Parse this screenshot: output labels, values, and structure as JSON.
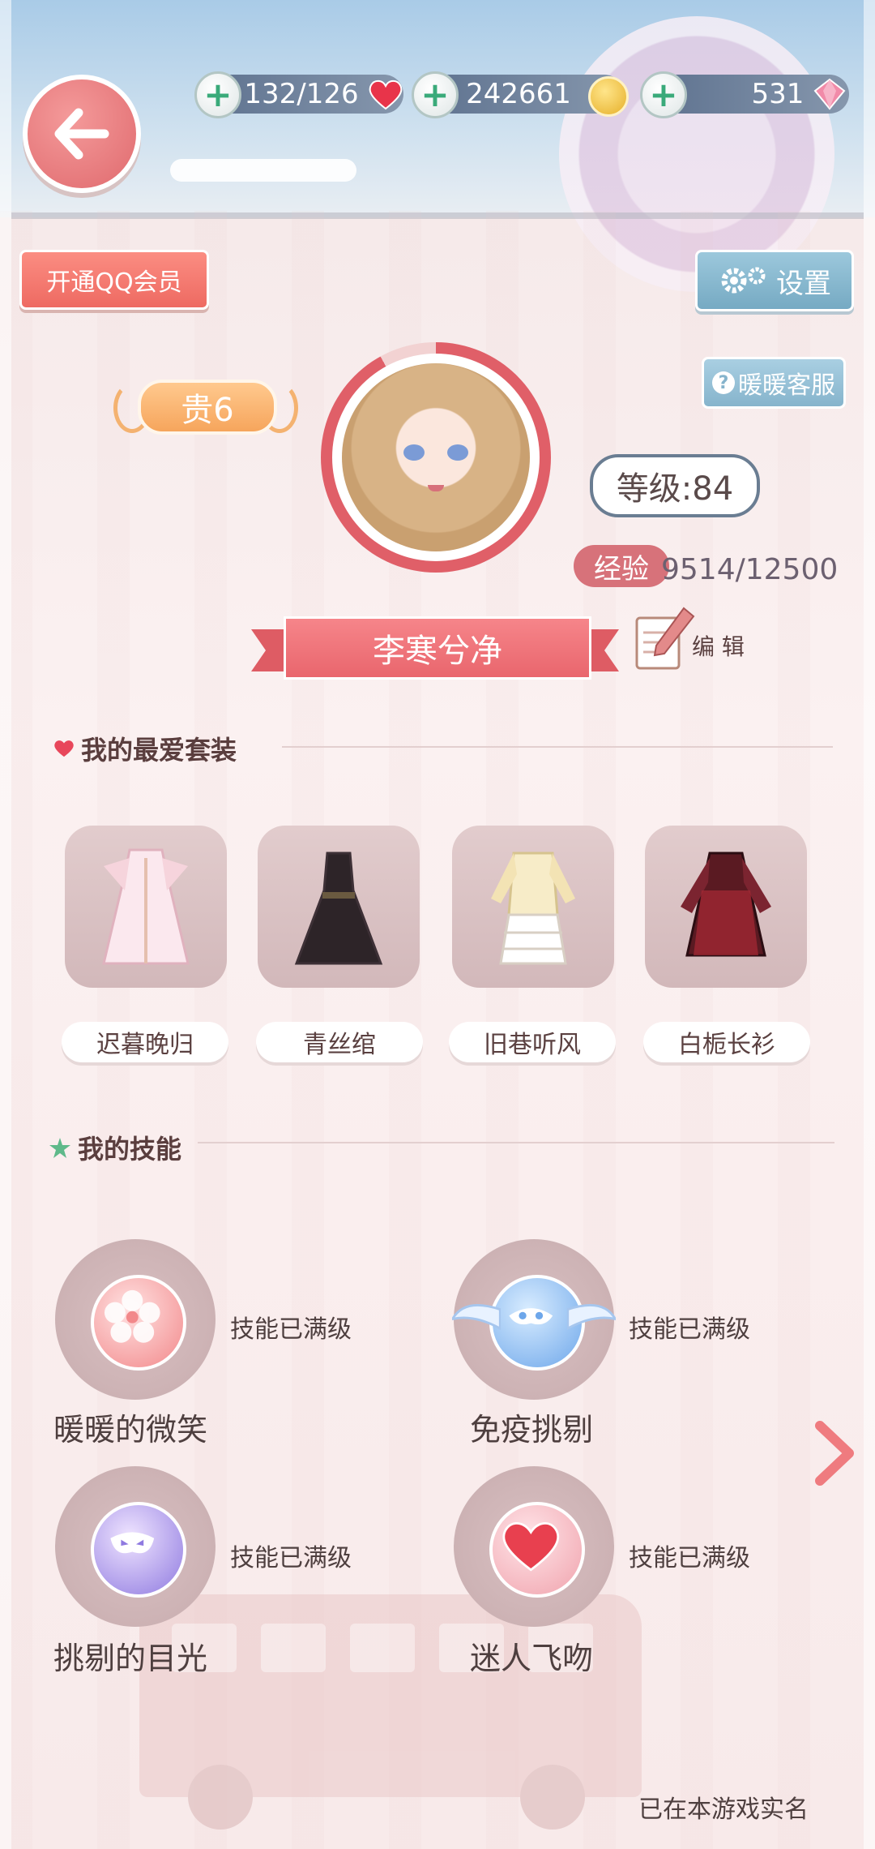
{
  "topbar": {
    "stamina": "132/126",
    "gold": "242661",
    "diamonds": "531"
  },
  "buttons": {
    "qq_vip": "开通QQ会员",
    "settings": "设置",
    "customer_service": "暖暖客服"
  },
  "profile": {
    "vip_level": "贵6",
    "level": "等级:84",
    "exp_label": "经验",
    "exp_value": "9514/12500",
    "name": "李寒兮净",
    "edit_label": "编 辑"
  },
  "favorite_outfits": {
    "title": "我的最爱套装",
    "items": [
      {
        "label": "迟暮晚归"
      },
      {
        "label": "青丝绾"
      },
      {
        "label": "旧巷听风"
      },
      {
        "label": "白栀长衫"
      }
    ]
  },
  "skills": {
    "title": "我的技能",
    "items": [
      {
        "name": "暖暖的微笑",
        "status": "技能已满级"
      },
      {
        "name": "免疫挑剔",
        "status": "技能已满级"
      },
      {
        "name": "挑剔的目光",
        "status": "技能已满级"
      },
      {
        "name": "迷人飞吻",
        "status": "技能已满级"
      }
    ]
  },
  "footer": {
    "realname_note": "已在本游戏实名"
  },
  "colors": {
    "accent_pink": "#e9666d",
    "button_blue": "#76aac3",
    "vip_orange": "#f6a55c"
  }
}
